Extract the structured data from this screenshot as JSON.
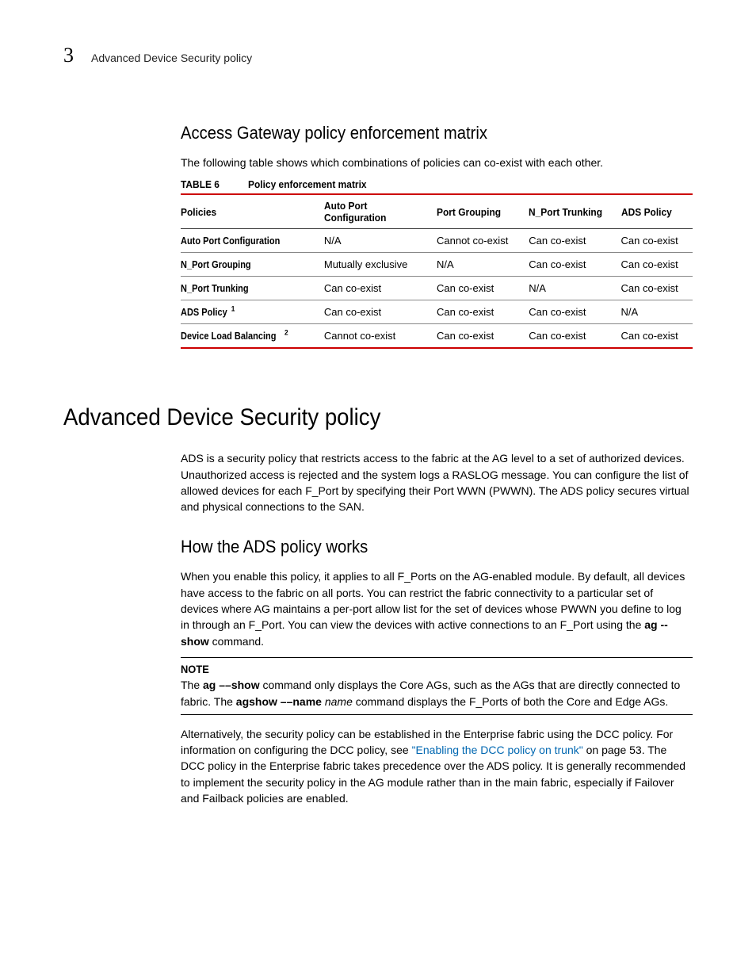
{
  "runhead": {
    "num": "3",
    "text": "Advanced Device Security policy"
  },
  "section1": {
    "heading": "Access Gateway policy enforcement matrix",
    "intro": "The following table shows which combinations of policies can co-exist with each other.",
    "table_label": "TABLE 6",
    "table_title": "Policy enforcement matrix",
    "headers": [
      "Policies",
      "Auto Port Configuration",
      "Port Grouping",
      "N_Port Trunking",
      "ADS Policy"
    ],
    "rows": [
      {
        "name": "Auto Port Configuration",
        "sup": "",
        "cells": [
          "N/A",
          "Cannot co-exist",
          "Can co-exist",
          "Can co-exist"
        ]
      },
      {
        "name": "N_Port Grouping",
        "sup": "",
        "cells": [
          "Mutually exclusive",
          "N/A",
          "Can co-exist",
          "Can co-exist"
        ]
      },
      {
        "name": "N_Port Trunking",
        "sup": "",
        "cells": [
          "Can co-exist",
          "Can co-exist",
          "N/A",
          "Can co-exist"
        ]
      },
      {
        "name": "ADS Policy",
        "sup": "1",
        "cells": [
          "Can co-exist",
          "Can co-exist",
          "Can co-exist",
          "N/A"
        ]
      },
      {
        "name": "Device Load Balancing",
        "sup": "2",
        "cells": [
          "Cannot co-exist",
          "Can co-exist",
          "Can co-exist",
          "Can co-exist"
        ]
      }
    ]
  },
  "chapter": {
    "heading": "Advanced Device Security policy",
    "p1": "ADS is a security policy that restricts access to the fabric at the AG level to a set of authorized devices. Unauthorized access is rejected and the system logs a RASLOG message. You can configure the list of allowed devices for each F_Port by specifying their Port WWN (PWWN). The ADS policy secures virtual and physical connections to the SAN."
  },
  "section2": {
    "heading": "How the ADS policy works",
    "p1_a": "When you enable this policy, it applies to all F_Ports on the AG-enabled module. By default, all devices have access to the fabric on all ports. You can restrict the fabric connectivity to a particular set of devices where AG maintains a per-port allow list for the set of devices whose PWWN you define to log in through an F_Port. You can view the devices with active connections to an F_Port using the ",
    "p1_cmd": "ag --show",
    "p1_b": " command.",
    "note_label": "NOTE",
    "note_a": "The ",
    "note_cmd1a": "ag",
    "note_gap1": "    ",
    "note_cmd1b": "show",
    "note_b": " command only displays the Core AGs, such as the AGs that are directly connected to fabric. The ",
    "note_cmd2a": "agshow",
    "note_gap2": "    ",
    "note_cmd2b": "name",
    "note_space": " ",
    "note_arg": "name",
    "note_c": " command displays the F_Ports of both the Core and Edge AGs.",
    "p2_a": "Alternatively, the security policy can be established in the Enterprise fabric using the DCC policy. For information on configuring the DCC policy, see ",
    "p2_link": "\"Enabling the DCC policy on trunk\"",
    "p2_b": " on page 53. The DCC policy in the Enterprise fabric takes precedence over the ADS policy. It is generally recommended to implement the security policy in the AG module rather than in the main fabric, especially if Failover and Failback policies are enabled."
  },
  "chart_data": {
    "type": "table",
    "title": "Policy enforcement matrix",
    "columns": [
      "Policies",
      "Auto Port Configuration",
      "Port Grouping",
      "N_Port Trunking",
      "ADS Policy"
    ],
    "rows": [
      [
        "Auto Port Configuration",
        "N/A",
        "Cannot co-exist",
        "Can co-exist",
        "Can co-exist"
      ],
      [
        "N_Port Grouping",
        "Mutually exclusive",
        "N/A",
        "Can co-exist",
        "Can co-exist"
      ],
      [
        "N_Port Trunking",
        "Can co-exist",
        "Can co-exist",
        "N/A",
        "Can co-exist"
      ],
      [
        "ADS Policy",
        "Can co-exist",
        "Can co-exist",
        "Can co-exist",
        "N/A"
      ],
      [
        "Device Load Balancing",
        "Cannot co-exist",
        "Can co-exist",
        "Can co-exist",
        "Can co-exist"
      ]
    ]
  }
}
